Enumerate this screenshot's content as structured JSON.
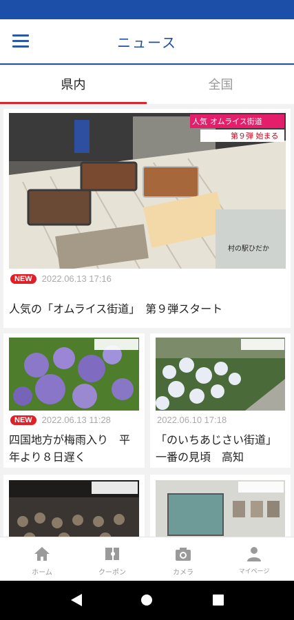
{
  "header": {
    "title": "ニュース",
    "menu_icon": "hamburger-menu-icon"
  },
  "tabs": [
    {
      "label": "県内",
      "active": true
    },
    {
      "label": "全国",
      "active": false
    }
  ],
  "articles": [
    {
      "badge": "NEW",
      "date": "2022.06.13 17:16",
      "title": "人気の「オムライス街道」　第９弾スタート",
      "overlay": {
        "tag": "人気",
        "title": "オムライス街道",
        "sub": "第９弾 始まる",
        "location": "村の駅ひだか"
      }
    },
    {
      "badge": "NEW",
      "date": "2022.06.13 11:28",
      "title_lines": [
        "四国地方が梅雨入り　平",
        "年より８日遅く"
      ]
    },
    {
      "badge": "",
      "date": "2022.06.10 17:18",
      "title_lines": [
        "「のいちあじさい街道」",
        "一番の見頃　高知"
      ]
    },
    {
      "badge": "",
      "date": "",
      "title": ""
    },
    {
      "badge": "",
      "date": "",
      "title": ""
    }
  ],
  "bottom_nav": [
    {
      "label": "ホーム",
      "icon": "home-icon"
    },
    {
      "label": "クーポン",
      "icon": "coupon-icon"
    },
    {
      "label": "カメラ",
      "icon": "camera-icon"
    },
    {
      "label": "マイページ",
      "icon": "person-icon"
    }
  ],
  "colors": {
    "brand": "#1b4fa8",
    "accent": "#d9262b",
    "new_badge": "#e01f27"
  }
}
